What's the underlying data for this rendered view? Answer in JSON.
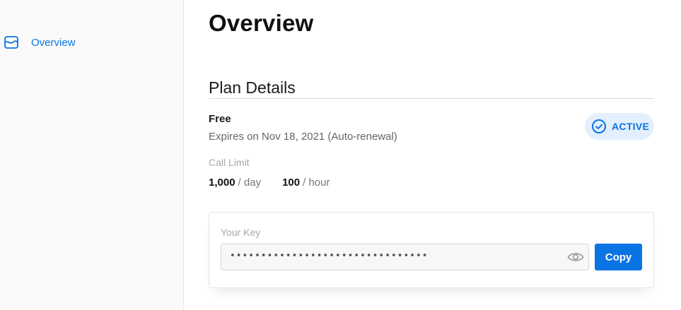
{
  "sidebar": {
    "items": [
      {
        "label": "Overview",
        "icon": "dashboard-icon",
        "active": true
      }
    ]
  },
  "main": {
    "title": "Overview",
    "plan": {
      "section_title": "Plan Details",
      "name": "Free",
      "expiry": "Expires on Nov 18, 2021 (Auto-renewal)",
      "status": {
        "label": "ACTIVE",
        "icon": "check-circle-icon"
      },
      "call_limit": {
        "label": "Call Limit",
        "day": {
          "value": "1,000",
          "unit": "/ day"
        },
        "hour": {
          "value": "100",
          "unit": "/ hour"
        }
      }
    },
    "key": {
      "label": "Your Key",
      "masked_value": "••••••••••••••••••••••••••••••••",
      "reveal_icon": "eye-icon",
      "copy_label": "Copy"
    }
  },
  "colors": {
    "accent": "#0b74e5",
    "badge_bg": "#e3effc",
    "sidebar_bg": "#fafafa"
  }
}
